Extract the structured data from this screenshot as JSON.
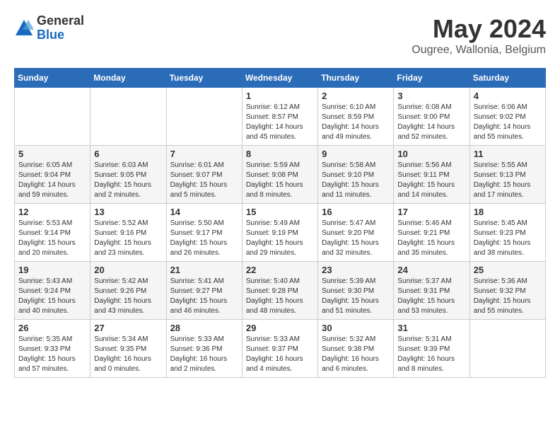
{
  "logo": {
    "general": "General",
    "blue": "Blue"
  },
  "title": {
    "month": "May 2024",
    "location": "Ougree, Wallonia, Belgium"
  },
  "days_of_week": [
    "Sunday",
    "Monday",
    "Tuesday",
    "Wednesday",
    "Thursday",
    "Friday",
    "Saturday"
  ],
  "weeks": [
    [
      {
        "day": "",
        "info": ""
      },
      {
        "day": "",
        "info": ""
      },
      {
        "day": "",
        "info": ""
      },
      {
        "day": "1",
        "info": "Sunrise: 6:12 AM\nSunset: 8:57 PM\nDaylight: 14 hours\nand 45 minutes."
      },
      {
        "day": "2",
        "info": "Sunrise: 6:10 AM\nSunset: 8:59 PM\nDaylight: 14 hours\nand 49 minutes."
      },
      {
        "day": "3",
        "info": "Sunrise: 6:08 AM\nSunset: 9:00 PM\nDaylight: 14 hours\nand 52 minutes."
      },
      {
        "day": "4",
        "info": "Sunrise: 6:06 AM\nSunset: 9:02 PM\nDaylight: 14 hours\nand 55 minutes."
      }
    ],
    [
      {
        "day": "5",
        "info": "Sunrise: 6:05 AM\nSunset: 9:04 PM\nDaylight: 14 hours\nand 59 minutes."
      },
      {
        "day": "6",
        "info": "Sunrise: 6:03 AM\nSunset: 9:05 PM\nDaylight: 15 hours\nand 2 minutes."
      },
      {
        "day": "7",
        "info": "Sunrise: 6:01 AM\nSunset: 9:07 PM\nDaylight: 15 hours\nand 5 minutes."
      },
      {
        "day": "8",
        "info": "Sunrise: 5:59 AM\nSunset: 9:08 PM\nDaylight: 15 hours\nand 8 minutes."
      },
      {
        "day": "9",
        "info": "Sunrise: 5:58 AM\nSunset: 9:10 PM\nDaylight: 15 hours\nand 11 minutes."
      },
      {
        "day": "10",
        "info": "Sunrise: 5:56 AM\nSunset: 9:11 PM\nDaylight: 15 hours\nand 14 minutes."
      },
      {
        "day": "11",
        "info": "Sunrise: 5:55 AM\nSunset: 9:13 PM\nDaylight: 15 hours\nand 17 minutes."
      }
    ],
    [
      {
        "day": "12",
        "info": "Sunrise: 5:53 AM\nSunset: 9:14 PM\nDaylight: 15 hours\nand 20 minutes."
      },
      {
        "day": "13",
        "info": "Sunrise: 5:52 AM\nSunset: 9:16 PM\nDaylight: 15 hours\nand 23 minutes."
      },
      {
        "day": "14",
        "info": "Sunrise: 5:50 AM\nSunset: 9:17 PM\nDaylight: 15 hours\nand 26 minutes."
      },
      {
        "day": "15",
        "info": "Sunrise: 5:49 AM\nSunset: 9:19 PM\nDaylight: 15 hours\nand 29 minutes."
      },
      {
        "day": "16",
        "info": "Sunrise: 5:47 AM\nSunset: 9:20 PM\nDaylight: 15 hours\nand 32 minutes."
      },
      {
        "day": "17",
        "info": "Sunrise: 5:46 AM\nSunset: 9:21 PM\nDaylight: 15 hours\nand 35 minutes."
      },
      {
        "day": "18",
        "info": "Sunrise: 5:45 AM\nSunset: 9:23 PM\nDaylight: 15 hours\nand 38 minutes."
      }
    ],
    [
      {
        "day": "19",
        "info": "Sunrise: 5:43 AM\nSunset: 9:24 PM\nDaylight: 15 hours\nand 40 minutes."
      },
      {
        "day": "20",
        "info": "Sunrise: 5:42 AM\nSunset: 9:26 PM\nDaylight: 15 hours\nand 43 minutes."
      },
      {
        "day": "21",
        "info": "Sunrise: 5:41 AM\nSunset: 9:27 PM\nDaylight: 15 hours\nand 46 minutes."
      },
      {
        "day": "22",
        "info": "Sunrise: 5:40 AM\nSunset: 9:28 PM\nDaylight: 15 hours\nand 48 minutes."
      },
      {
        "day": "23",
        "info": "Sunrise: 5:39 AM\nSunset: 9:30 PM\nDaylight: 15 hours\nand 51 minutes."
      },
      {
        "day": "24",
        "info": "Sunrise: 5:37 AM\nSunset: 9:31 PM\nDaylight: 15 hours\nand 53 minutes."
      },
      {
        "day": "25",
        "info": "Sunrise: 5:36 AM\nSunset: 9:32 PM\nDaylight: 15 hours\nand 55 minutes."
      }
    ],
    [
      {
        "day": "26",
        "info": "Sunrise: 5:35 AM\nSunset: 9:33 PM\nDaylight: 15 hours\nand 57 minutes."
      },
      {
        "day": "27",
        "info": "Sunrise: 5:34 AM\nSunset: 9:35 PM\nDaylight: 16 hours\nand 0 minutes."
      },
      {
        "day": "28",
        "info": "Sunrise: 5:33 AM\nSunset: 9:36 PM\nDaylight: 16 hours\nand 2 minutes."
      },
      {
        "day": "29",
        "info": "Sunrise: 5:33 AM\nSunset: 9:37 PM\nDaylight: 16 hours\nand 4 minutes."
      },
      {
        "day": "30",
        "info": "Sunrise: 5:32 AM\nSunset: 9:38 PM\nDaylight: 16 hours\nand 6 minutes."
      },
      {
        "day": "31",
        "info": "Sunrise: 5:31 AM\nSunset: 9:39 PM\nDaylight: 16 hours\nand 8 minutes."
      },
      {
        "day": "",
        "info": ""
      }
    ]
  ]
}
